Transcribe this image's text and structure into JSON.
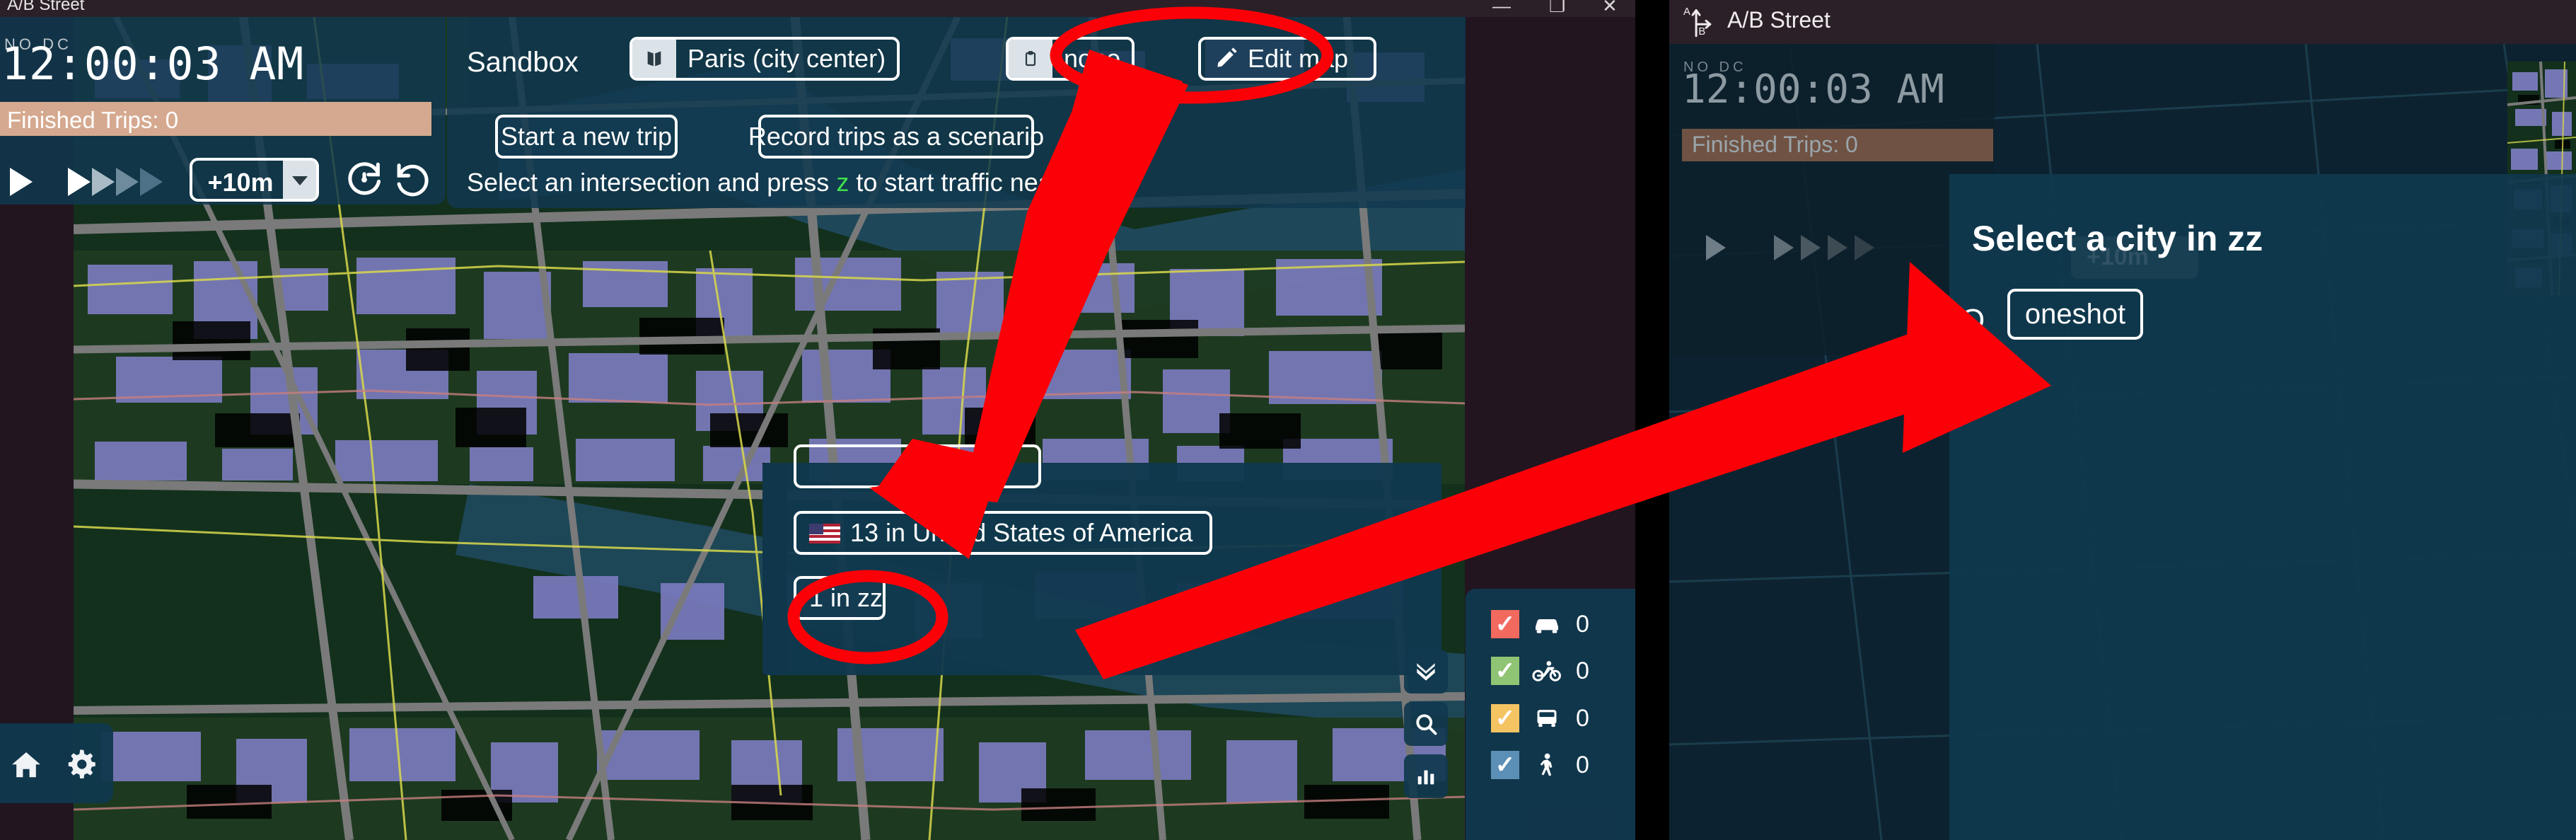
{
  "left_window": {
    "title": "A/B Street",
    "window_controls": {
      "minimize": "—",
      "maximize": "❐",
      "close": "✕"
    },
    "sim_hud": {
      "sub_time": "NO DC",
      "clock": "12:00:03 AM",
      "finished_trips": "Finished Trips: 0",
      "jump_time_label": "+10m",
      "play_icon": "play-icon",
      "fast_forward_icon": "fast-forward-icon",
      "reset_icon": "reset-sim-icon",
      "undo_icon": "undo-sim-icon"
    },
    "sandbox": {
      "title": "Sandbox",
      "map_picker": {
        "icon": "map-icon",
        "label": "Paris (city center)"
      },
      "scenario_picker": {
        "icon": "clipboard-icon",
        "label": "none"
      },
      "edit_map": {
        "icon": "pencil-icon",
        "label": "Edit map"
      },
      "start_trip": "Start a new trip",
      "record_scenario": "Record trips as a scenario",
      "hint_before": "Select an intersection and press ",
      "hint_key": "z",
      "hint_after": " to start traffic nearby"
    },
    "city_panel": {
      "rows": [
        {
          "flag": "",
          "label": ""
        },
        {
          "flag": "flag-usa",
          "label": "13 in United States of America"
        },
        {
          "flag": "",
          "label": "1 in zz"
        }
      ]
    },
    "map_tools": [
      {
        "name": "layers-icon",
        "label": "layers"
      },
      {
        "name": "search-icon",
        "label": "search"
      },
      {
        "name": "chart-icon",
        "label": "charts"
      }
    ],
    "agents": [
      {
        "mode": "car",
        "icon": "car-icon",
        "color": "#f2695e",
        "count": "0",
        "checked": true
      },
      {
        "mode": "bike",
        "icon": "bike-icon",
        "color": "#8fc474",
        "count": "0",
        "checked": true
      },
      {
        "mode": "bus",
        "icon": "bus-icon",
        "color": "#f5c462",
        "count": "0",
        "checked": true
      },
      {
        "mode": "pedestrian",
        "icon": "pedestrian-icon",
        "color": "#5b8fb5",
        "count": "0",
        "checked": true
      }
    ],
    "bottom_left": {
      "home": "home-icon",
      "settings": "gear-icon"
    }
  },
  "right_window": {
    "title": "A/B Street",
    "logo": "ab-street-logo-icon",
    "sim_hud": {
      "sub_time": "NO DC",
      "clock": "12:00:03 AM",
      "finished_trips": "Finished Trips: 0",
      "jump_time_label": "+10m"
    },
    "modal": {
      "title": "Select a city in zz",
      "group_letter": "O",
      "city_button": "oneshot"
    }
  },
  "colors": {
    "panel_bg": "#10384e",
    "accent_white": "#ffffff",
    "highlight_key": "#3fe04b",
    "finished_trips_bar": "#d5a98f",
    "annotation_red": "#fb0007",
    "map_building": "#7b7bbe",
    "map_green": "#1d3b21",
    "map_road": "#7a7a7a",
    "map_water": "#1f4a5e"
  },
  "annotations": {
    "ellipse_map_picker": "red-ellipse-highlight",
    "ellipse_city_zz": "red-ellipse-highlight",
    "arrow_down_to_city_panel": "red-arrow",
    "arrow_up_to_right_modal": "red-arrow"
  }
}
